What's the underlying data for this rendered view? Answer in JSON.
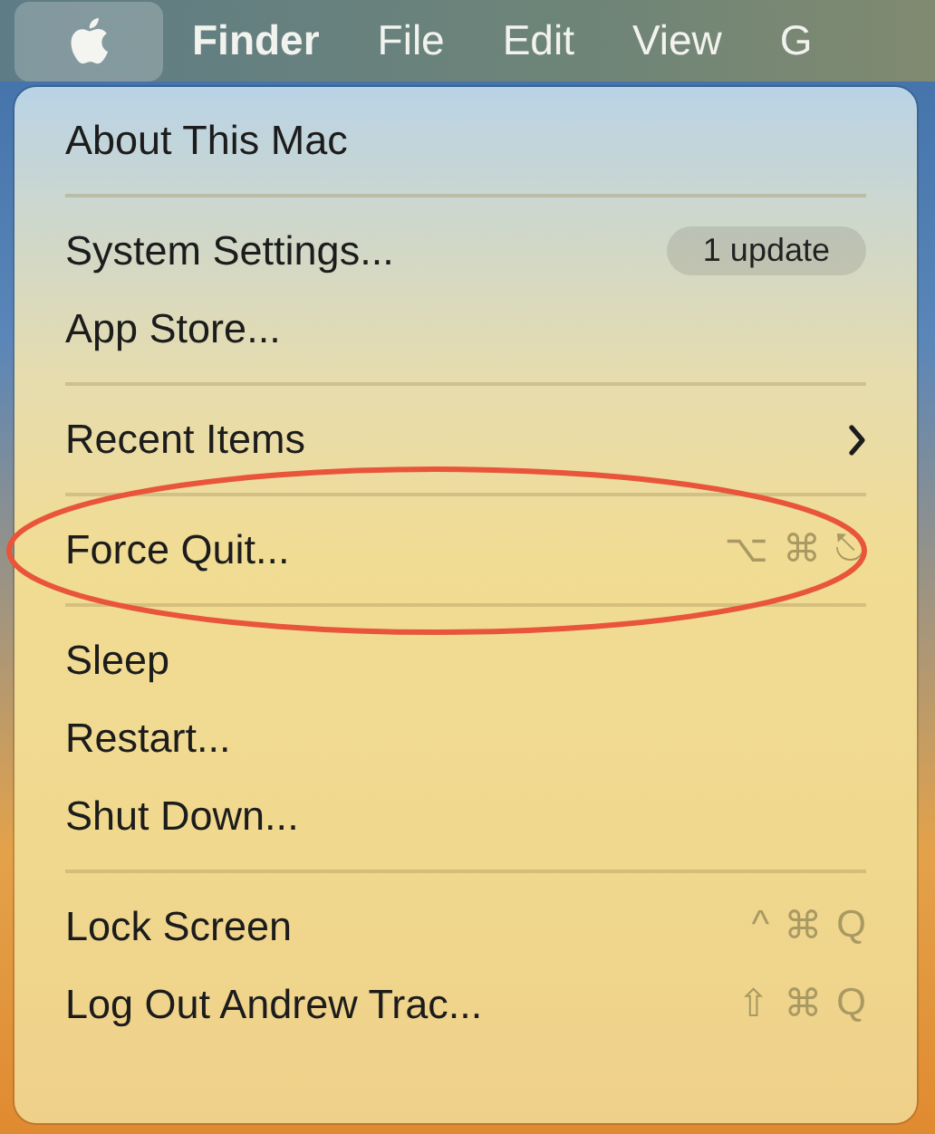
{
  "menu_bar": [
    {
      "kind": "apple",
      "selected": true
    },
    {
      "kind": "text",
      "label": "Finder",
      "bold": true,
      "selected": false
    },
    {
      "kind": "text",
      "label": "File",
      "bold": false,
      "selected": false
    },
    {
      "kind": "text",
      "label": "Edit",
      "bold": false,
      "selected": false
    },
    {
      "kind": "text",
      "label": "View",
      "bold": false,
      "selected": false
    },
    {
      "kind": "text",
      "label": "G",
      "bold": false,
      "selected": false
    }
  ],
  "menu": {
    "sections": [
      [
        {
          "label": "About This Mac"
        }
      ],
      [
        {
          "label": "System Settings...",
          "badge": "1 update"
        },
        {
          "label": "App Store..."
        }
      ],
      [
        {
          "label": "Recent Items",
          "submenu": true
        }
      ],
      [
        {
          "label": "Force Quit...",
          "shortcut": [
            "⌥",
            "⌘",
            "⎋"
          ],
          "circled": true
        }
      ],
      [
        {
          "label": "Sleep"
        },
        {
          "label": "Restart..."
        },
        {
          "label": "Shut Down..."
        }
      ],
      [
        {
          "label": "Lock Screen",
          "shortcut": [
            "^",
            "⌘",
            "Q"
          ]
        },
        {
          "label": "Log Out Andrew Trac...",
          "shortcut": [
            "⇧",
            "⌘",
            "Q"
          ]
        }
      ]
    ]
  }
}
